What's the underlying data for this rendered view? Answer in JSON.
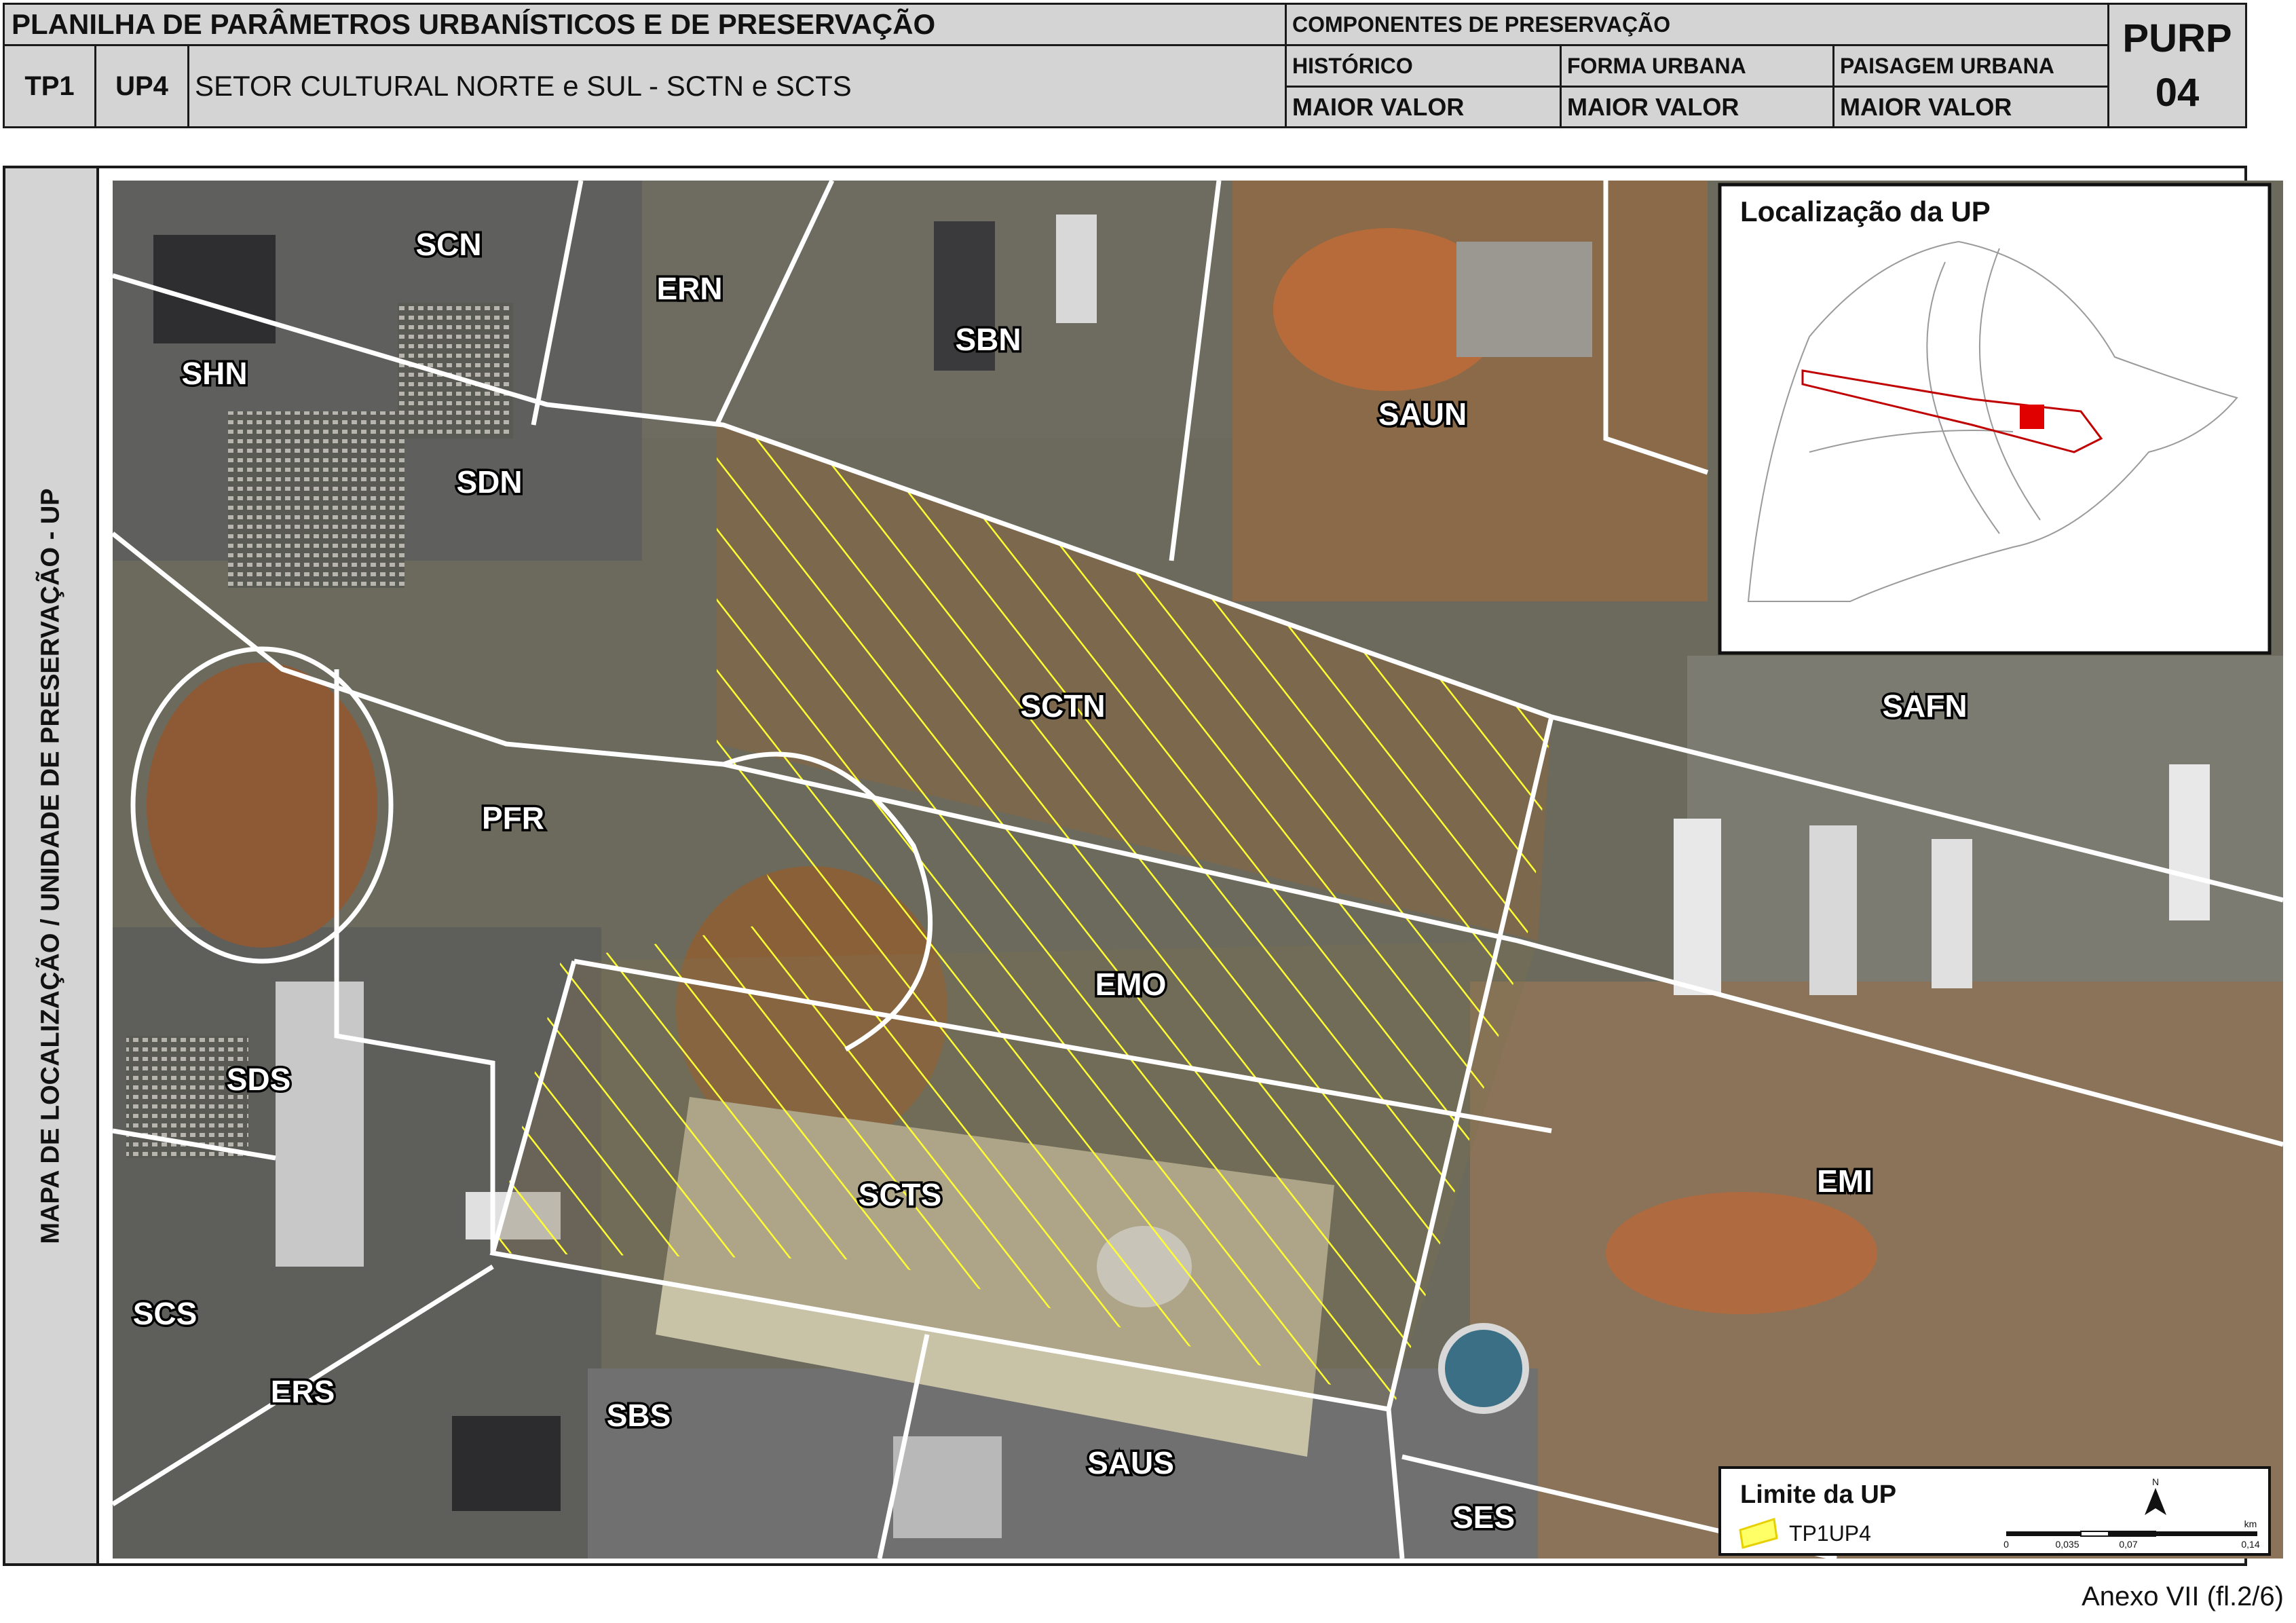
{
  "header": {
    "title": "PLANILHA DE PARÂMETROS URBANÍSTICOS E DE PRESERVAÇÃO",
    "tp": "TP1",
    "up": "UP4",
    "sector": "SETOR CULTURAL NORTE e SUL - SCTN e SCTS",
    "components_title": "COMPONENTES DE PRESERVAÇÃO",
    "components": [
      {
        "name": "HISTÓRICO",
        "value": "MAIOR VALOR"
      },
      {
        "name": "FORMA URBANA",
        "value": "MAIOR VALOR"
      },
      {
        "name": "PAISAGEM URBANA",
        "value": "MAIOR VALOR"
      }
    ],
    "code_top": "PURP",
    "code_bottom": "04"
  },
  "sidebar_label": "MAPA DE LOCALIZAÇÃO / UNIDADE DE PRESERVAÇÃO - UP",
  "map": {
    "labels": {
      "scn": "SCN",
      "ern": "ERN",
      "shn": "SHN",
      "sbn": "SBN",
      "sdn": "SDN",
      "saun": "SAUN",
      "sctn": "SCTN",
      "safn": "SAFN",
      "pfr": "PFR",
      "emo": "EMO",
      "sds": "SDS",
      "scts": "SCTS",
      "emi": "EMI",
      "scs": "SCS",
      "ers": "ERS",
      "sbs": "SBS",
      "saus": "SAUS",
      "ses": "SES"
    },
    "inset_title": "Localização da UP",
    "legend_title": "Limite da UP",
    "legend_item": "TP1UP4",
    "north": "N",
    "scale_unit": "km",
    "scale_ticks": [
      "0",
      "0,035",
      "0,07",
      "0,14"
    ],
    "colors": {
      "hatch": "#ffff33",
      "boundary": "#ffffff",
      "highlight": "#e00000"
    }
  },
  "footer": "Anexo VII (fl.2/6)"
}
